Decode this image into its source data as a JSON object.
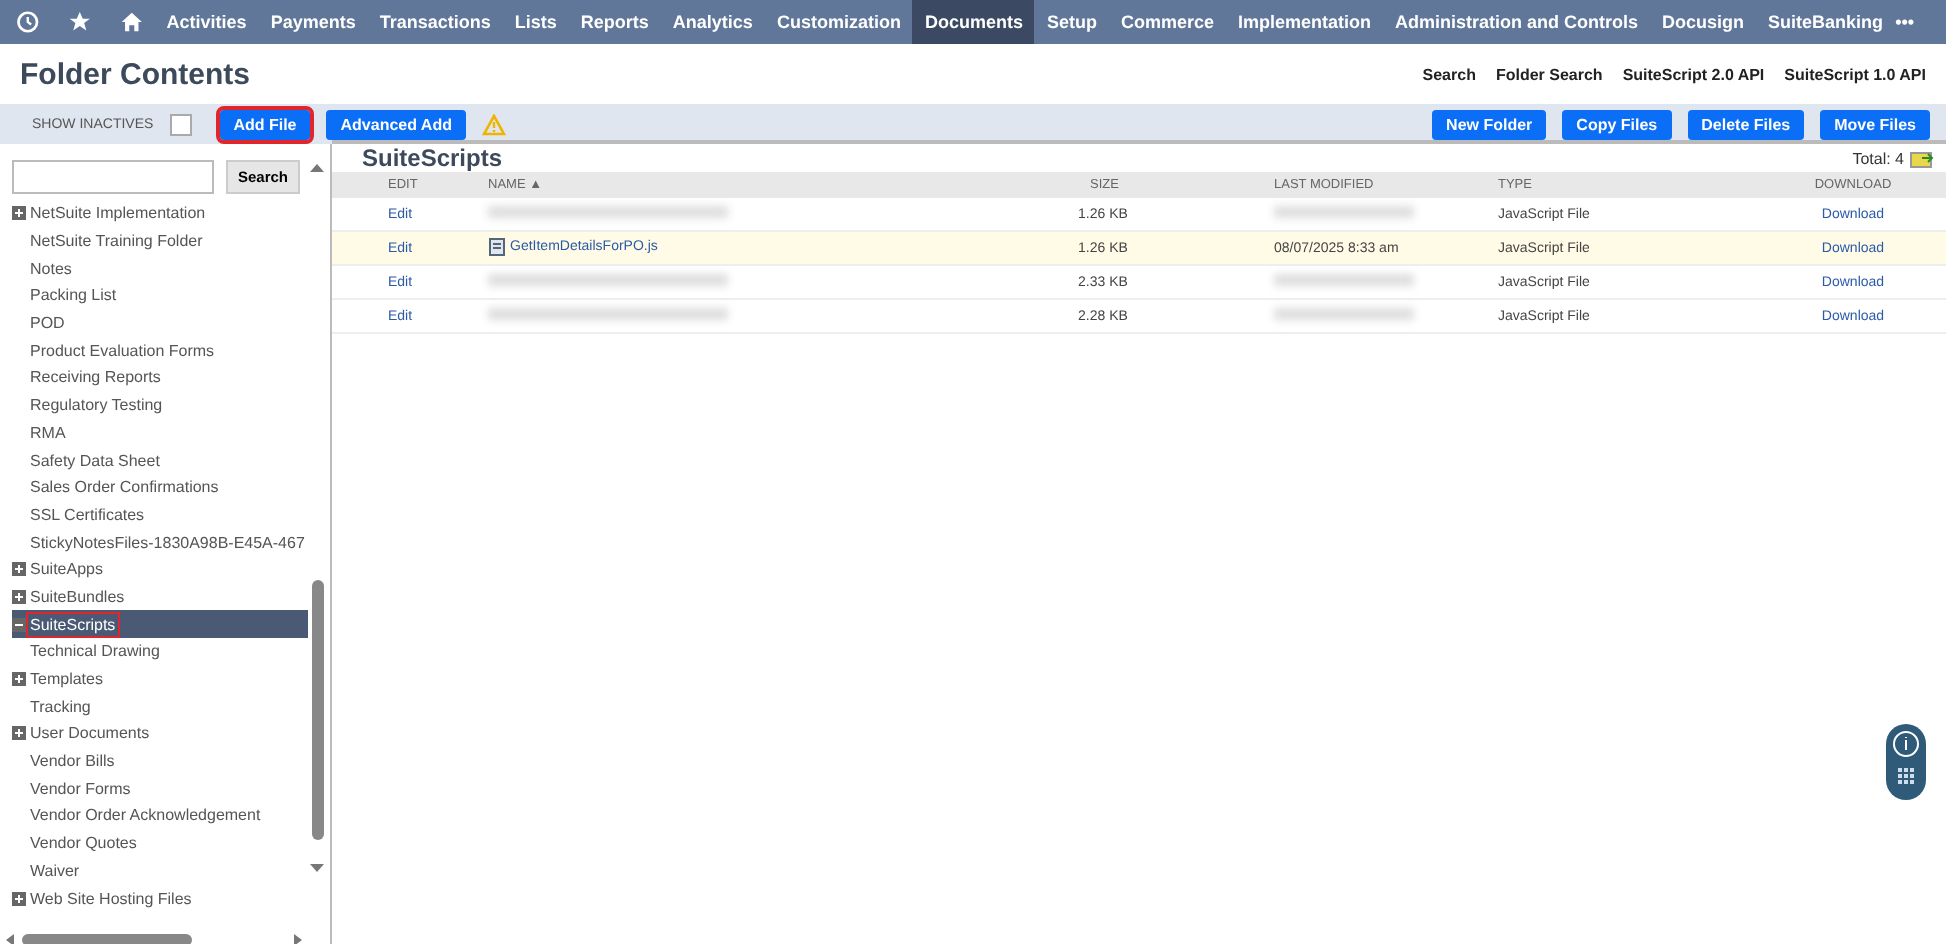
{
  "nav": {
    "items": [
      {
        "label": "Activities",
        "selected": false
      },
      {
        "label": "Payments",
        "selected": false
      },
      {
        "label": "Transactions",
        "selected": false
      },
      {
        "label": "Lists",
        "selected": false
      },
      {
        "label": "Reports",
        "selected": false
      },
      {
        "label": "Analytics",
        "selected": false
      },
      {
        "label": "Customization",
        "selected": false
      },
      {
        "label": "Documents",
        "selected": true
      },
      {
        "label": "Setup",
        "selected": false
      },
      {
        "label": "Commerce",
        "selected": false
      },
      {
        "label": "Implementation",
        "selected": false
      },
      {
        "label": "Administration and Controls",
        "selected": false
      },
      {
        "label": "Docusign",
        "selected": false
      },
      {
        "label": "SuiteBanking",
        "selected": false
      }
    ],
    "more": "•••"
  },
  "page_title": "Folder Contents",
  "header_links": [
    "Search",
    "Folder Search",
    "SuiteScript 2.0 API",
    "SuiteScript 1.0 API"
  ],
  "toolbar": {
    "show_inactives": {
      "label": "SHOW INACTIVES",
      "checked": false
    },
    "left_buttons": [
      {
        "label": "Add File",
        "highlighted": true
      },
      {
        "label": "Advanced Add",
        "highlighted": false
      }
    ],
    "right_buttons": [
      "New Folder",
      "Copy Files",
      "Delete Files",
      "Move Files"
    ]
  },
  "search_button": "Search",
  "tree": [
    {
      "label": "NetSuite Implementation",
      "kind": "collapsed",
      "selected": false,
      "highlighted": false
    },
    {
      "label": "NetSuite Training Folder",
      "kind": "plain",
      "selected": false,
      "highlighted": false
    },
    {
      "label": "Notes",
      "kind": "plain",
      "selected": false,
      "highlighted": false
    },
    {
      "label": "Packing List",
      "kind": "plain",
      "selected": false,
      "highlighted": false
    },
    {
      "label": "POD",
      "kind": "plain",
      "selected": false,
      "highlighted": false
    },
    {
      "label": "Product Evaluation Forms",
      "kind": "plain",
      "selected": false,
      "highlighted": false
    },
    {
      "label": "Receiving Reports",
      "kind": "plain",
      "selected": false,
      "highlighted": false
    },
    {
      "label": "Regulatory Testing",
      "kind": "plain",
      "selected": false,
      "highlighted": false
    },
    {
      "label": "RMA",
      "kind": "plain",
      "selected": false,
      "highlighted": false
    },
    {
      "label": "Safety Data Sheet",
      "kind": "plain",
      "selected": false,
      "highlighted": false
    },
    {
      "label": "Sales Order Confirmations",
      "kind": "plain",
      "selected": false,
      "highlighted": false
    },
    {
      "label": "SSL Certificates",
      "kind": "plain",
      "selected": false,
      "highlighted": false
    },
    {
      "label": "StickyNotesFiles-1830A98B-E45A-467",
      "kind": "plain",
      "selected": false,
      "highlighted": false
    },
    {
      "label": "SuiteApps",
      "kind": "collapsed",
      "selected": false,
      "highlighted": false
    },
    {
      "label": "SuiteBundles",
      "kind": "collapsed",
      "selected": false,
      "highlighted": false
    },
    {
      "label": "SuiteScripts",
      "kind": "expanded",
      "selected": true,
      "highlighted": true
    },
    {
      "label": "Technical Drawing",
      "kind": "plain",
      "selected": false,
      "highlighted": false
    },
    {
      "label": "Templates",
      "kind": "collapsed",
      "selected": false,
      "highlighted": false
    },
    {
      "label": "Tracking",
      "kind": "plain",
      "selected": false,
      "highlighted": false
    },
    {
      "label": "User Documents",
      "kind": "collapsed",
      "selected": false,
      "highlighted": false
    },
    {
      "label": "Vendor Bills",
      "kind": "plain",
      "selected": false,
      "highlighted": false
    },
    {
      "label": "Vendor Forms",
      "kind": "plain",
      "selected": false,
      "highlighted": false
    },
    {
      "label": "Vendor Order Acknowledgement",
      "kind": "plain",
      "selected": false,
      "highlighted": false
    },
    {
      "label": "Vendor Quotes",
      "kind": "plain",
      "selected": false,
      "highlighted": false
    },
    {
      "label": "Waiver",
      "kind": "plain",
      "selected": false,
      "highlighted": false
    },
    {
      "label": "Web Site Hosting Files",
      "kind": "collapsed",
      "selected": false,
      "highlighted": false
    }
  ],
  "folder": {
    "title": "SuiteScripts",
    "total": "Total: 4",
    "columns": [
      "EDIT",
      "NAME ▲",
      "SIZE",
      "LAST MODIFIED",
      "TYPE",
      "DOWNLOAD"
    ],
    "rows": [
      {
        "edit": "Edit",
        "size": "1.26 KB",
        "type": "JavaScript File",
        "download": "Download",
        "selected": false
      },
      {
        "edit": "Edit",
        "name": "GetItemDetailsForPO.js",
        "size": "1.26 KB",
        "modified": "08/07/2025 8:33 am",
        "type": "JavaScript File",
        "download": "Download",
        "selected": true
      },
      {
        "edit": "Edit",
        "size": "2.33 KB",
        "type": "JavaScript File",
        "download": "Download",
        "selected": false
      },
      {
        "edit": "Edit",
        "size": "2.28 KB",
        "type": "JavaScript File",
        "download": "Download",
        "selected": false
      }
    ]
  }
}
